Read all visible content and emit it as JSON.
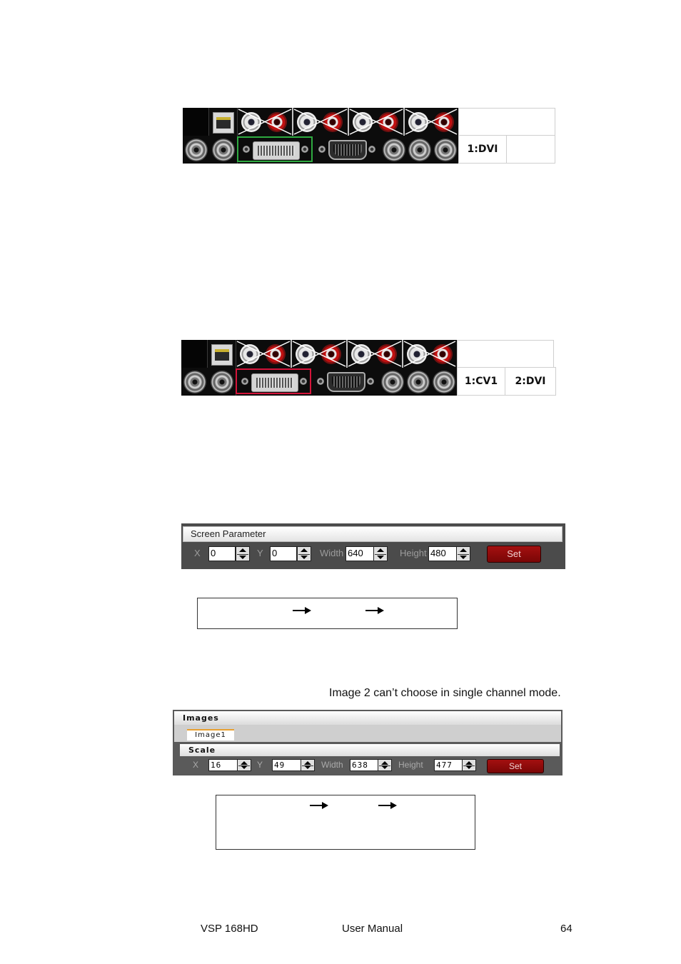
{
  "panel1": {
    "labels": [
      "1:DVI",
      ""
    ]
  },
  "panel2": {
    "labels": [
      "1:CV1",
      "2:DVI"
    ]
  },
  "screen_parameter": {
    "title": "Screen Parameter",
    "x_label": "X",
    "x_value": "0",
    "y_label": "Y",
    "y_value": "0",
    "width_label": "Width",
    "width_value": "640",
    "height_label": "Height",
    "height_value": "480",
    "set_label": "Set"
  },
  "note": "Image 2 can’t choose in single channel mode.",
  "images_panel": {
    "title": "Images",
    "tab": "Image1",
    "scale_title": "Scale",
    "x_label": "X",
    "x_value": "16",
    "y_label": "Y",
    "y_value": "49",
    "width_label": "Width",
    "width_value": "638",
    "height_label": "Height",
    "height_value": "477",
    "set_label": "Set"
  },
  "footer": {
    "product": "VSP 168HD",
    "doc": "User Manual",
    "page": "64"
  }
}
